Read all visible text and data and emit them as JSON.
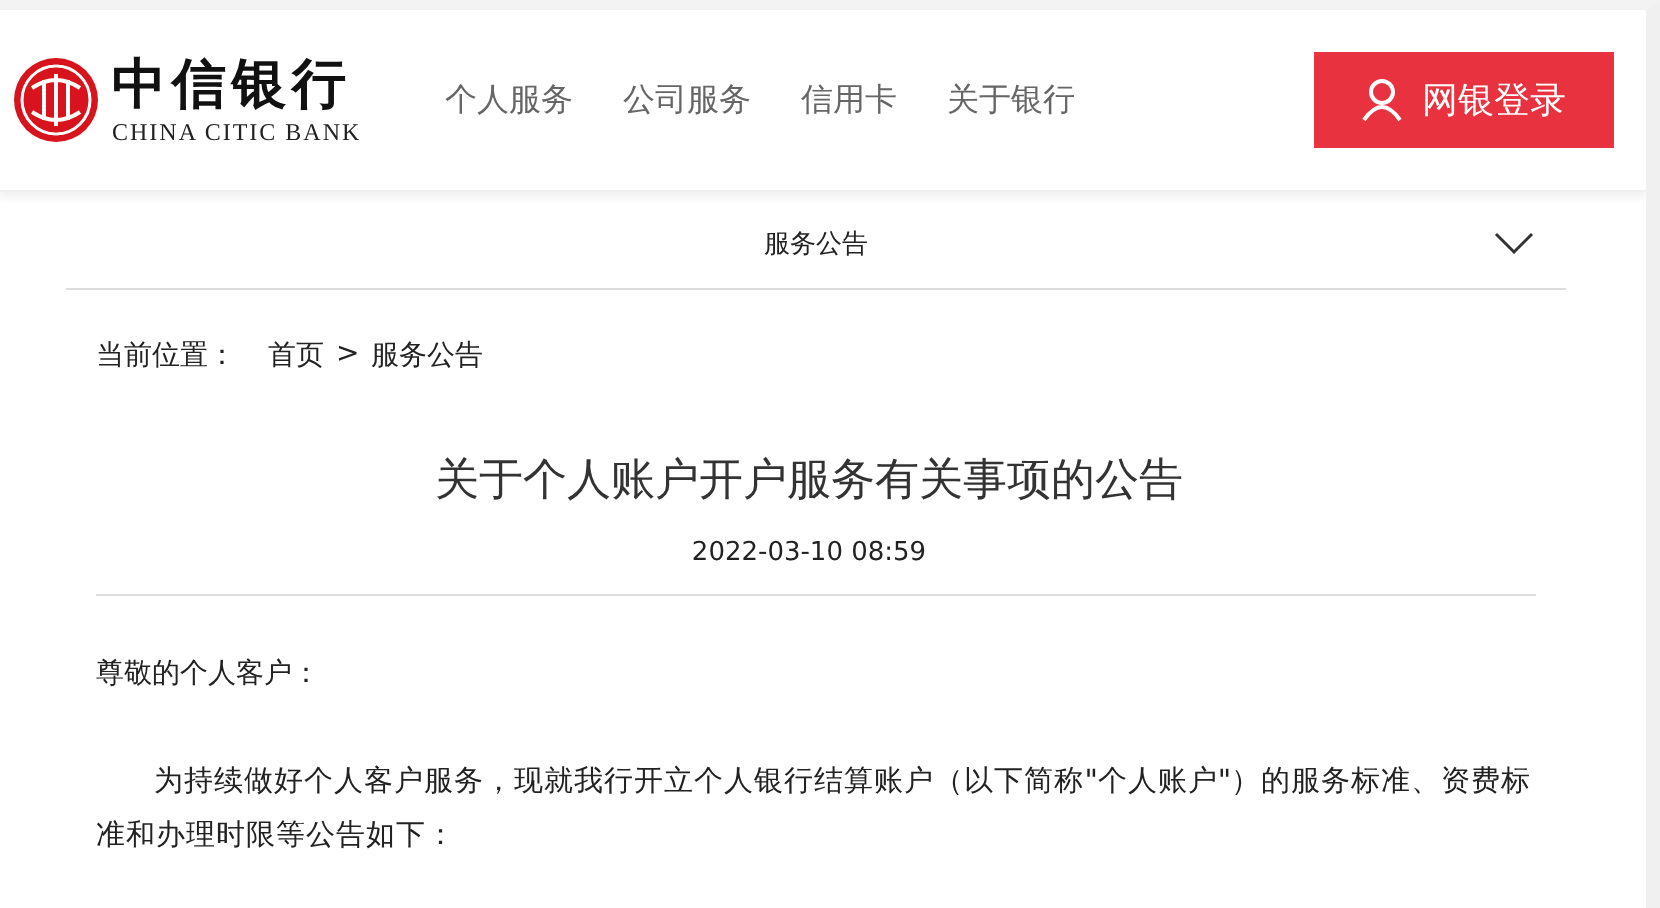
{
  "header": {
    "logo": {
      "name": "中信银行",
      "subtitle": "CHINA CITIC BANK"
    },
    "nav": [
      "个人服务",
      "公司服务",
      "信用卡",
      "关于银行"
    ],
    "login_button": "网银登录"
  },
  "section_bar": {
    "title": "服务公告"
  },
  "breadcrumb": {
    "label": "当前位置：",
    "items": [
      "首页",
      "服务公告"
    ],
    "separator": ">"
  },
  "article": {
    "title": "关于个人账户开户服务有关事项的公告",
    "date": "2022-03-10 08:59",
    "greeting": "尊敬的个人客户：",
    "paragraphs": [
      "为持续做好个人客户服务，现就我行开立个人银行结算账户（以下简称\"个人账户\"）的服务标准、资费标准和办理时限等公告如下："
    ]
  }
}
